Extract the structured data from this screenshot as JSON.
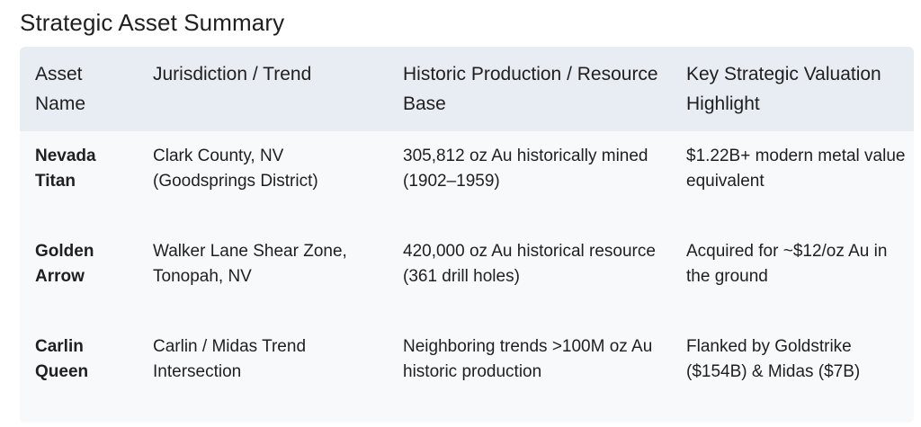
{
  "title": "Strategic Asset Summary",
  "table": {
    "headers": {
      "asset": "Asset Name",
      "jurisdiction": "Jurisdiction / Trend",
      "production": "Historic Production / Resource Base",
      "valuation": "Key Strategic Valuation Highlight"
    },
    "rows": [
      {
        "asset": "Nevada Titan",
        "jurisdiction": "Clark County, NV (Goodsprings District)",
        "production": "305,812 oz Au historically mined (1902–1959)",
        "valuation": "$1.22B+ modern metal value equivalent"
      },
      {
        "asset": "Golden Arrow",
        "jurisdiction": "Walker Lane Shear Zone, Tonopah, NV",
        "production": "420,000 oz Au historical resource (361 drill holes)",
        "valuation": "Acquired for ~$12/oz Au in the ground"
      },
      {
        "asset": "Carlin Queen",
        "jurisdiction": "Carlin / Midas Trend Intersection",
        "production": "Neighboring trends >100M oz Au historic production",
        "valuation": "Flanked by Goldstrike ($154B) & Midas ($7B)"
      }
    ]
  }
}
